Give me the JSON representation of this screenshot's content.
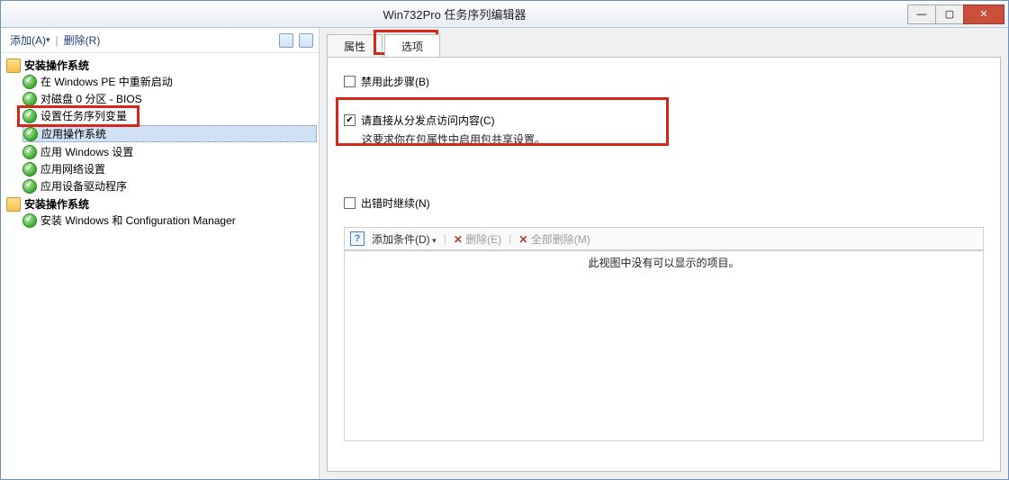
{
  "window": {
    "title": "Win732Pro 任务序列编辑器"
  },
  "left_toolbar": {
    "add": "添加(A)",
    "remove": "删除(R)"
  },
  "tree": {
    "group1": {
      "label": "安装操作系统",
      "items": [
        "在 Windows PE 中重新启动",
        "对磁盘 0 分区 - BIOS",
        "设置任务序列变量",
        "应用操作系统",
        "应用 Windows 设置",
        "应用网络设置",
        "应用设备驱动程序"
      ]
    },
    "group2": {
      "label": "安装操作系统",
      "items": [
        "安装 Windows 和 Configuration Manager"
      ]
    }
  },
  "tabs": {
    "properties": "属性",
    "options": "选项"
  },
  "options_pane": {
    "disable_step": "禁用此步骤(B)",
    "access_content": "请直接从分发点访问内容(C)",
    "access_content_note": "这要求你在包属性中启用包共享设置。",
    "continue_on_error": "出错时继续(N)",
    "add_condition": "添加条件(D)",
    "delete": "删除(E)",
    "delete_all": "全部删除(M)",
    "empty_list": "此视图中没有可以显示的项目。"
  }
}
